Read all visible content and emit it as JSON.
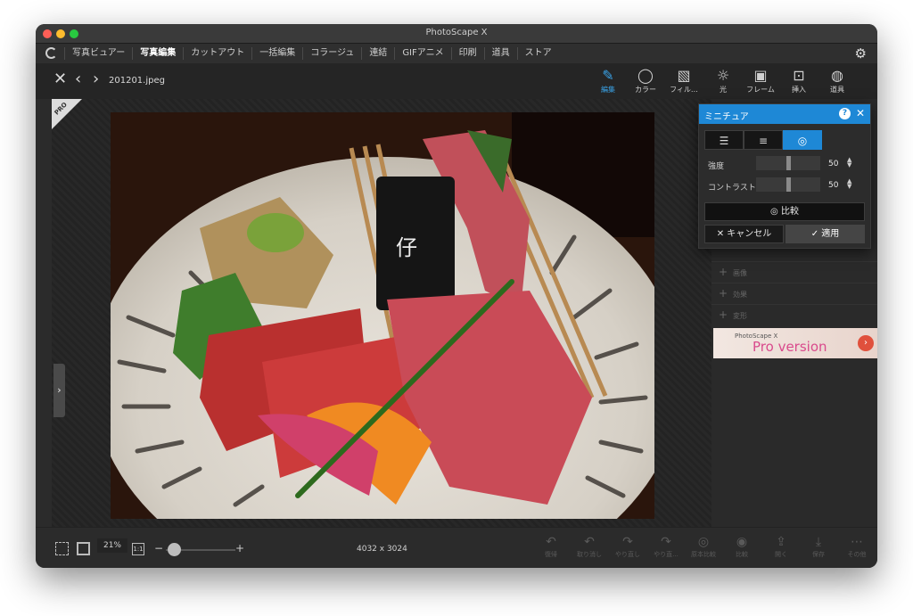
{
  "window": {
    "title": "PhotoScape X"
  },
  "menu": {
    "items": [
      {
        "label": "写真ビュアー",
        "active": false
      },
      {
        "label": "写真編集",
        "active": true
      },
      {
        "label": "カットアウト",
        "active": false
      },
      {
        "label": "一括編集",
        "active": false
      },
      {
        "label": "コラージュ",
        "active": false
      },
      {
        "label": "連結",
        "active": false
      },
      {
        "label": "GIFアニメ",
        "active": false
      },
      {
        "label": "印刷",
        "active": false
      },
      {
        "label": "道具",
        "active": false
      },
      {
        "label": "ストア",
        "active": false
      }
    ]
  },
  "toolbar": {
    "filename": "201201.jpeg",
    "tools": [
      {
        "label": "編集",
        "icon": "edit-icon",
        "active": true
      },
      {
        "label": "カラー",
        "icon": "color-circle-icon",
        "active": false
      },
      {
        "label": "フィル…",
        "icon": "filter-icon",
        "active": false
      },
      {
        "label": "光",
        "icon": "light-icon",
        "active": false
      },
      {
        "label": "フレーム",
        "icon": "frame-icon",
        "active": false
      },
      {
        "label": "挿入",
        "icon": "insert-icon",
        "active": false
      },
      {
        "label": "道具",
        "icon": "tools-icon",
        "active": false
      }
    ]
  },
  "canvas": {
    "pro_badge": "PRO"
  },
  "right_panel": {
    "rows": [
      "画像",
      "効果",
      "変形"
    ],
    "banner": {
      "line1": "PhotoScape X",
      "line2": "Pro version"
    }
  },
  "dialog": {
    "title": "ミニチュア",
    "tab_icons": [
      "filter-lines-icon",
      "menu-lines-icon",
      "circle-target-icon"
    ],
    "active_tab": 2,
    "params": [
      {
        "label": "強度",
        "value": "50",
        "level": 50
      },
      {
        "label": "コントラスト",
        "value": "50",
        "level": 50
      }
    ],
    "compare_label": "比較",
    "cancel_label": "キャンセル",
    "apply_label": "適用"
  },
  "bottom": {
    "zoom": "21%",
    "one_to_one": "1:1",
    "dimensions": "4032 x 3024",
    "actions": [
      {
        "label": "復帰",
        "icon": "revert-icon"
      },
      {
        "label": "取り消し",
        "icon": "undo-icon"
      },
      {
        "label": "やり直し",
        "icon": "redo-icon"
      },
      {
        "label": "やり直...",
        "icon": "redo-all-icon"
      },
      {
        "label": "原本比較",
        "icon": "compare-original-icon"
      },
      {
        "label": "比較",
        "icon": "compare-icon"
      },
      {
        "label": "開く",
        "icon": "open-icon"
      },
      {
        "label": "保存",
        "icon": "save-icon"
      },
      {
        "label": "その他",
        "icon": "more-icon"
      }
    ]
  },
  "colors": {
    "accent": "#1e88d6",
    "window_bg": "#2b2b2b",
    "close": "#ff5f57",
    "minimize": "#febc2e",
    "zoom": "#28c840"
  }
}
